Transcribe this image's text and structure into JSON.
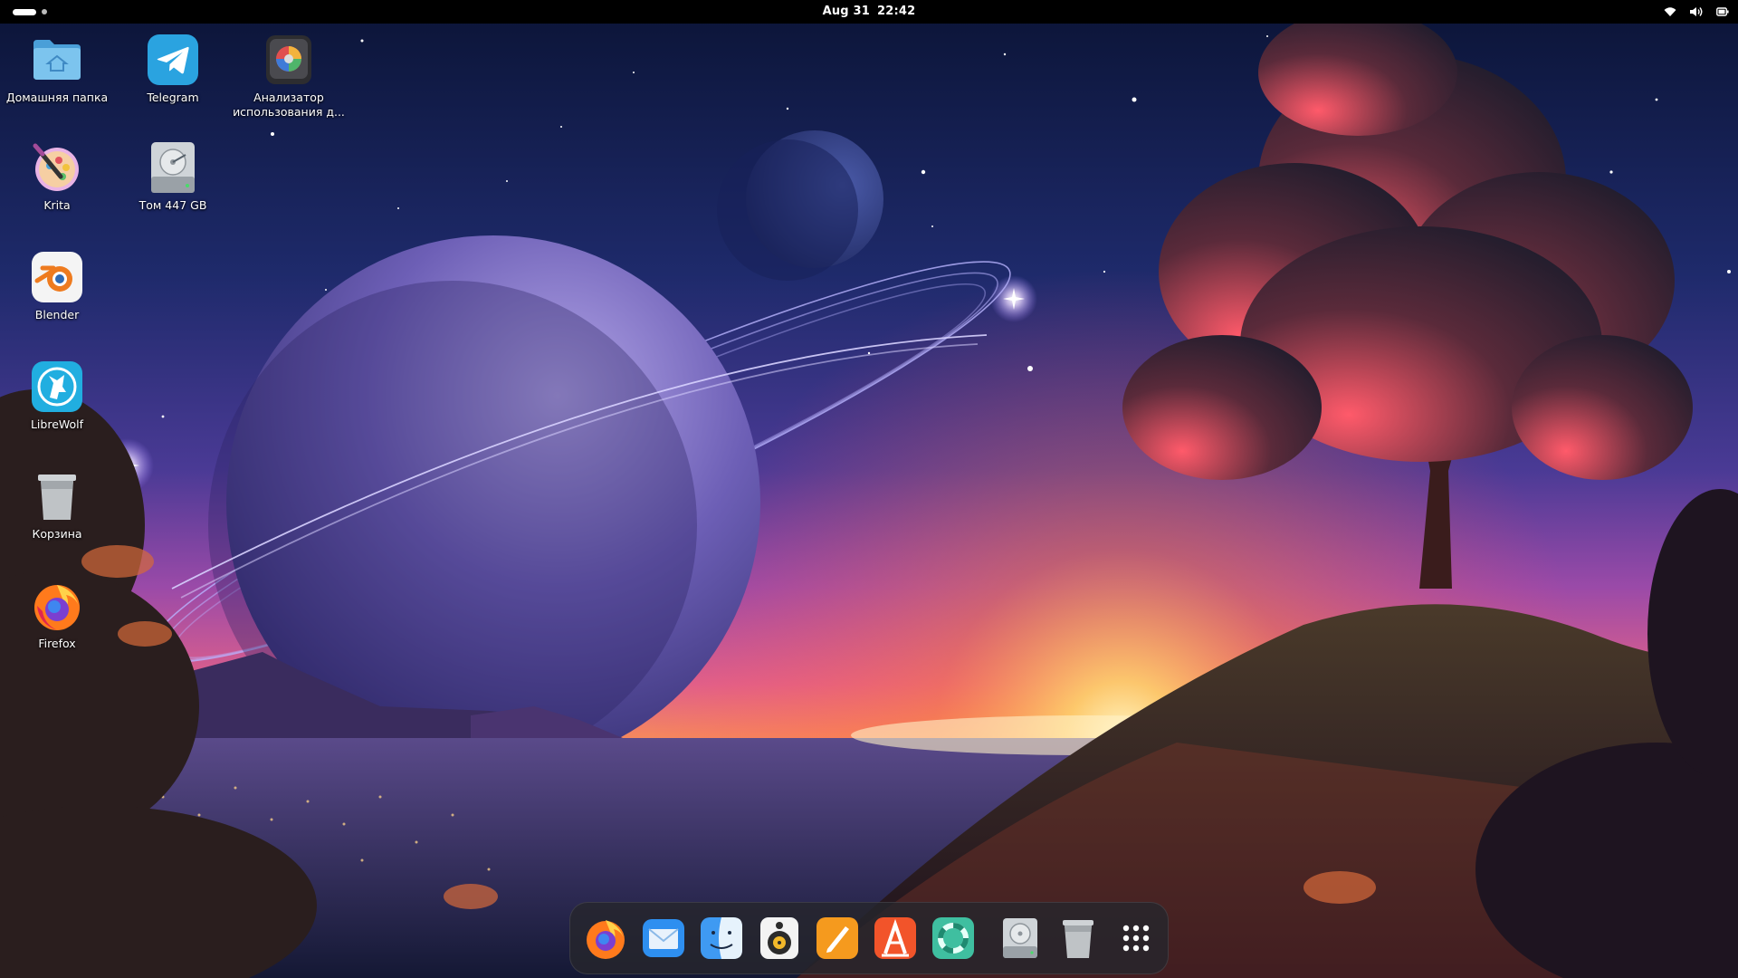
{
  "topbar": {
    "date": "Aug 31",
    "time": "22:42"
  },
  "tray_icons": [
    "wifi-icon",
    "volume-icon",
    "battery-icon"
  ],
  "desktop_icons": [
    {
      "label": "Домашняя папка",
      "icon": "home-folder-icon"
    },
    {
      "label": "Telegram",
      "icon": "telegram-icon"
    },
    {
      "label": "Анализатор\nиспользования д...",
      "icon": "disk-usage-analyzer-icon"
    },
    {
      "label": "Krita",
      "icon": "krita-icon"
    },
    {
      "label": "Том 447 GB",
      "icon": "hard-drive-icon"
    },
    {
      "label": "Blender",
      "icon": "blender-icon"
    },
    {
      "label": "LibreWolf",
      "icon": "librewolf-icon"
    },
    {
      "label": "Корзина",
      "icon": "trash-icon"
    },
    {
      "label": "Firefox",
      "icon": "firefox-icon"
    }
  ],
  "dock_items": [
    "firefox-icon",
    "mail-icon",
    "finder-icon",
    "rhythmbox-icon",
    "text-editor-icon",
    "app-store-icon",
    "help-lifebuoy-icon",
    "hard-drive-icon",
    "trash-icon",
    "show-apps-grid-icon"
  ],
  "colors": {
    "sky_top": "#0c1233",
    "sky_mid": "#3b2a7a",
    "horizon": "#ff9b3a",
    "planet": "#6b5fb8",
    "topbar": "#000000",
    "dock_bg": "#26262c"
  }
}
